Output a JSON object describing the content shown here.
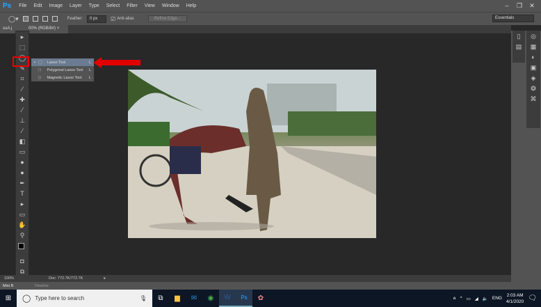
{
  "app": {
    "logo": "Ps",
    "menu": [
      "File",
      "Edit",
      "Image",
      "Layer",
      "Type",
      "Select",
      "Filter",
      "View",
      "Window",
      "Help"
    ]
  },
  "options": {
    "feather_label": "Feather:",
    "feather_value": "0 px",
    "antialias_label": "Anti-alias",
    "antialias_checked": true,
    "refine_edge": "Refine Edge...",
    "workspace": "Essentials"
  },
  "document": {
    "tab_prefix": "suA.j",
    "tab_title": "00% (RGB/8#)",
    "zoom": "100%",
    "doc_info": "Doc: 772.7K/772.7K"
  },
  "flyout": [
    {
      "label": "Lasso Tool",
      "key": "L",
      "selected": true
    },
    {
      "label": "Polygonal Lasso Tool",
      "key": "L",
      "selected": false
    },
    {
      "label": "Magnetic Lasso Tool",
      "key": "L",
      "selected": false
    }
  ],
  "panels": {
    "mini": "Mini B",
    "timeline": "Timeline"
  },
  "annotation": {
    "color": "#e00000"
  },
  "taskbar": {
    "search_placeholder": "Type here to search",
    "time": "2:03 AM",
    "date": "4/1/2020",
    "lang": "ENG"
  }
}
